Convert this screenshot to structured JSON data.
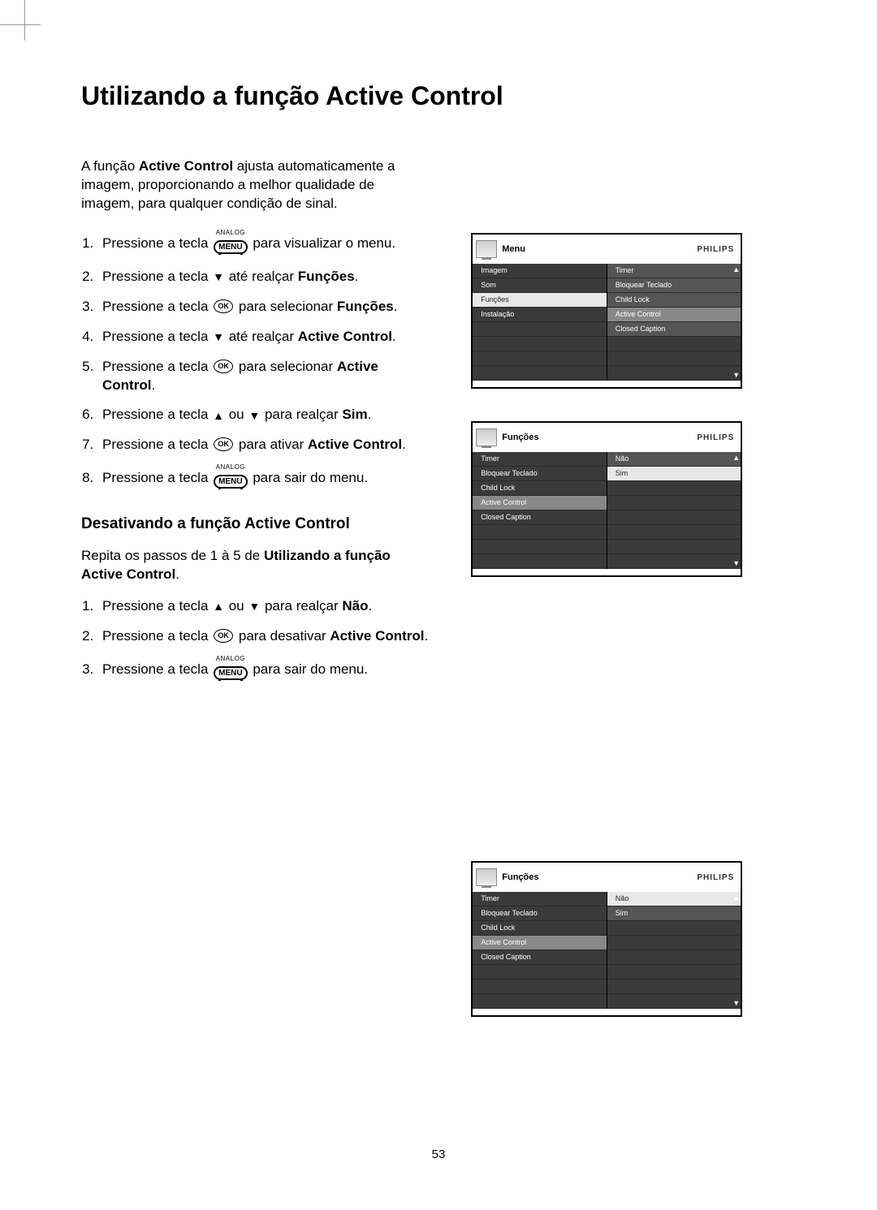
{
  "title": "Utilizando a função Active Control",
  "intro": "A função <b>Active Control</b> ajusta automaticamente a imagem, proporcionando a melhor qualidade de imagem, para qualquer condição de sinal.",
  "steps_main": [
    {
      "pre": "Pressione a tecla ",
      "icon": "menu",
      "post": " para visualizar o menu."
    },
    {
      "pre": "Pressione a tecla ",
      "icon": "down",
      "post": " até realçar <b>Funções</b>."
    },
    {
      "pre": "Pressione a tecla ",
      "icon": "ok",
      "post": " para selecionar <b>Funções</b>."
    },
    {
      "pre": "Pressione a tecla ",
      "icon": "down",
      "post": " até realçar <b>Active Control</b>."
    },
    {
      "pre": "Pressione a tecla ",
      "icon": "ok",
      "post": " para selecionar <b>Active Control</b>."
    },
    {
      "pre": "Pressione a tecla ",
      "icon": "updown",
      "post": " para realçar <b>Sim</b>."
    },
    {
      "pre": "Pressione a tecla ",
      "icon": "ok",
      "post": " para ativar <b>Active Control</b>."
    },
    {
      "pre": "Pressione a tecla ",
      "icon": "menu",
      "post": " para sair do menu."
    }
  ],
  "subheading": "Desativando a função Active Control",
  "repeat": "Repita os passos de 1 à 5 de <b>Utilizando a função Active Control</b>.",
  "steps_deact": [
    {
      "pre": "Pressione a tecla ",
      "icon": "updown",
      "post": " para realçar <b>Não</b>."
    },
    {
      "pre": "Pressione a tecla ",
      "icon": "ok",
      "post": " para desativar <b>Active Control</b>."
    },
    {
      "pre": "Pressione a tecla ",
      "icon": "menu",
      "post": " para sair do menu."
    }
  ],
  "button_labels": {
    "analog": "ANALOG",
    "menu": "MENU",
    "ok": "OK"
  },
  "brand": "PHILIPS",
  "panel1": {
    "title": "Menu",
    "left": [
      {
        "t": "Imagem",
        "cls": "dark"
      },
      {
        "t": "Som",
        "cls": "dark"
      },
      {
        "t": "Funções",
        "cls": "sel-white"
      },
      {
        "t": "Instalação",
        "cls": "dark"
      }
    ],
    "right": [
      {
        "t": "Timer",
        "cls": ""
      },
      {
        "t": "Bloquear Teclado",
        "cls": ""
      },
      {
        "t": "Child Lock",
        "cls": ""
      },
      {
        "t": "Active Control",
        "cls": "sel-grey"
      },
      {
        "t": "Closed Caption",
        "cls": ""
      }
    ]
  },
  "panel2": {
    "title": "Funções",
    "left": [
      {
        "t": "Timer",
        "cls": "dark"
      },
      {
        "t": "Bloquear Teclado",
        "cls": "dark"
      },
      {
        "t": "Child Lock",
        "cls": "dark"
      },
      {
        "t": "Active Control",
        "cls": "sel-grey"
      },
      {
        "t": "Closed Caption",
        "cls": "dark"
      }
    ],
    "right": [
      {
        "t": "Não",
        "cls": ""
      },
      {
        "t": "Sim",
        "cls": "sel-white"
      }
    ]
  },
  "panel3": {
    "title": "Funções",
    "left": [
      {
        "t": "Timer",
        "cls": "dark"
      },
      {
        "t": "Bloquear Teclado",
        "cls": "dark"
      },
      {
        "t": "Child Lock",
        "cls": "dark"
      },
      {
        "t": "Active Control",
        "cls": "sel-grey"
      },
      {
        "t": "Closed Caption",
        "cls": "dark"
      }
    ],
    "right": [
      {
        "t": "Não",
        "cls": "sel-white"
      },
      {
        "t": "Sim",
        "cls": ""
      }
    ]
  },
  "page_number": "53"
}
